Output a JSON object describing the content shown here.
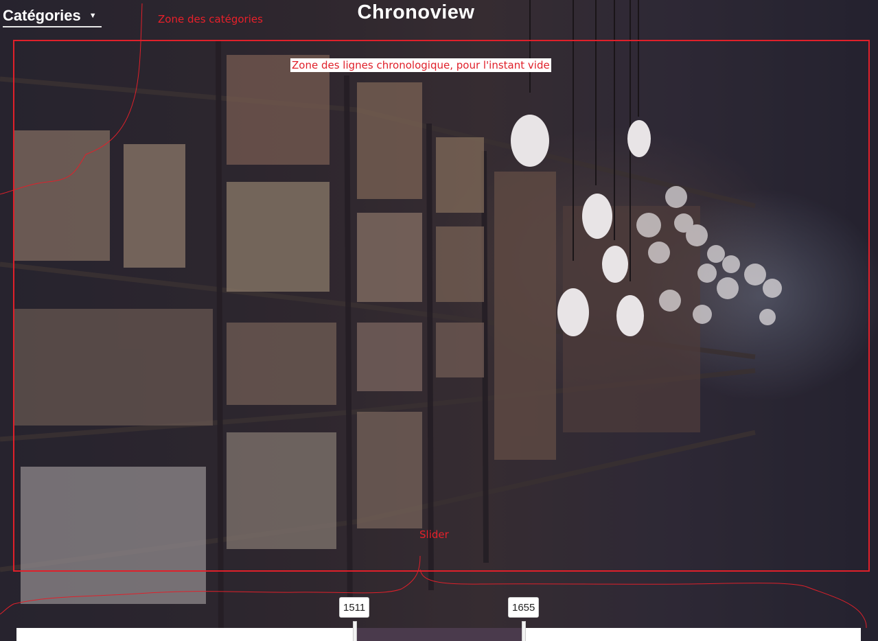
{
  "header": {
    "categories_label": "Catégories",
    "categories_caret": "▼",
    "title": "Chronoview"
  },
  "annotations": {
    "categories_zone": "Zone des catégories",
    "timeline_zone": "Zone des lignes chronologique, pour l'instant vide",
    "slider": "Slider"
  },
  "slider": {
    "min_label": "1511",
    "max_label": "1655"
  },
  "colors": {
    "annotation": "#e0202a",
    "slider_range": "#4a3a4c",
    "slider_track": "#ffffff"
  },
  "background": {
    "icon": "library-background-image"
  }
}
